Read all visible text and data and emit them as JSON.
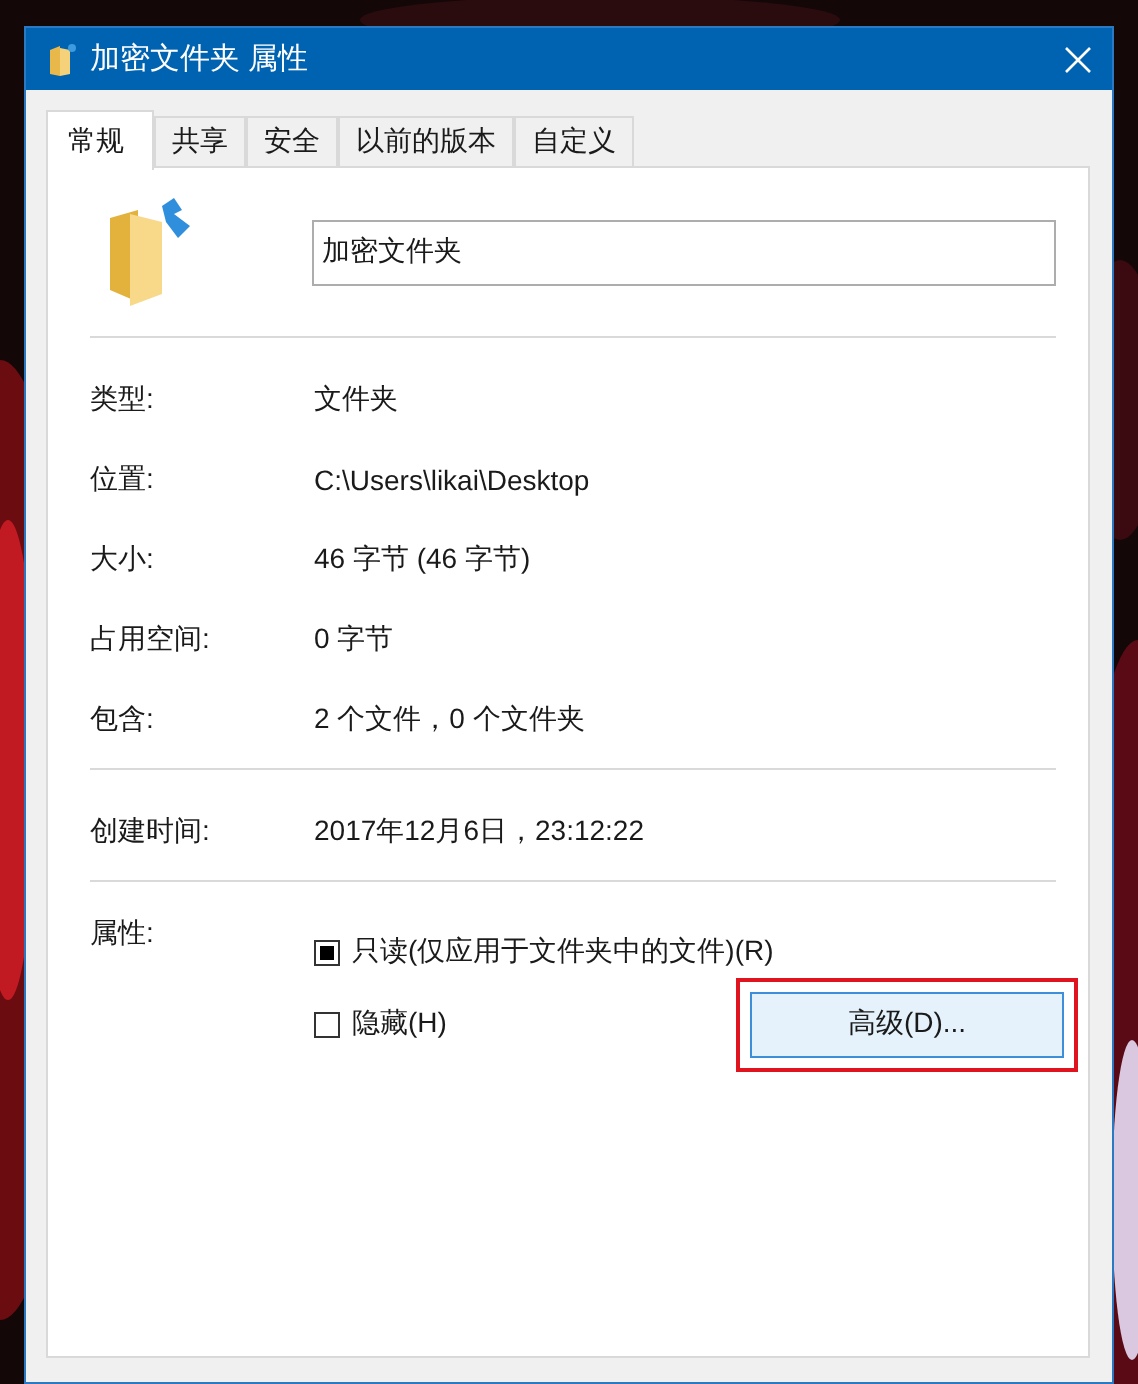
{
  "window": {
    "title": "加密文件夹 属性"
  },
  "tabs": [
    {
      "label": "常规",
      "selected": true
    },
    {
      "label": "共享",
      "selected": false
    },
    {
      "label": "安全",
      "selected": false
    },
    {
      "label": "以前的版本",
      "selected": false
    },
    {
      "label": "自定义",
      "selected": false
    }
  ],
  "name_field": {
    "value": "加密文件夹"
  },
  "sections": [
    [
      {
        "label": "类型:",
        "value": "文件夹"
      },
      {
        "label": "位置:",
        "value": "C:\\Users\\likai\\Desktop"
      },
      {
        "label": "大小:",
        "value": "46 字节 (46 字节)"
      },
      {
        "label": "占用空间:",
        "value": "0 字节"
      },
      {
        "label": "包含:",
        "value": "2 个文件，0 个文件夹"
      }
    ],
    [
      {
        "label": "创建时间:",
        "value": "2017年12月6日，23:12:22"
      }
    ]
  ],
  "attributes": {
    "label": "属性:",
    "options": [
      {
        "label": "只读(仅应用于文件夹中的文件)(R)",
        "indeterminate": true
      },
      {
        "label": "隐藏(H)",
        "indeterminate": false
      }
    ],
    "button": {
      "label": "高级(D)...",
      "highlighted": true
    }
  }
}
